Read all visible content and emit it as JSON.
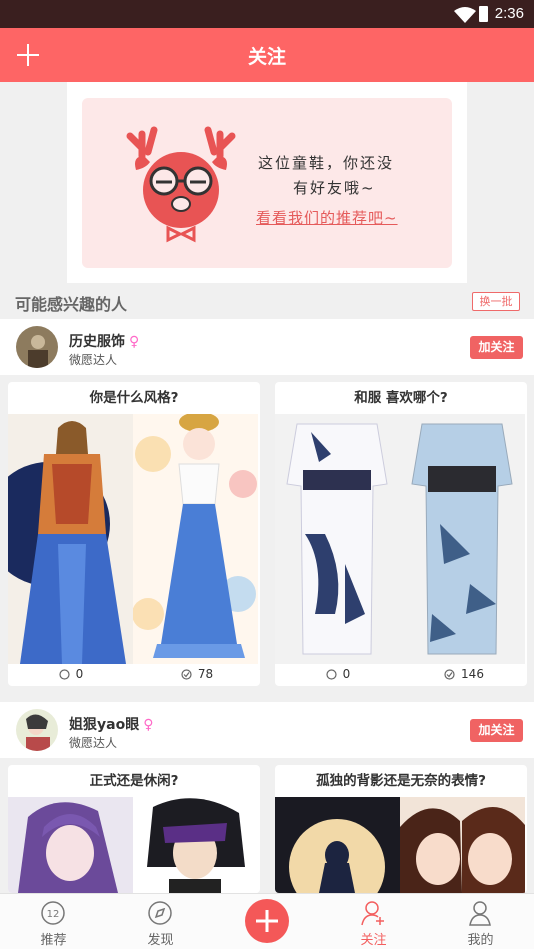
{
  "status_bar": {
    "time": "2:36"
  },
  "header": {
    "title": "关注",
    "add_icon": "plus-icon"
  },
  "banner": {
    "line1": "这位童鞋，你还没",
    "line2": "有好友哦~",
    "link": "看看我们的推荐吧~"
  },
  "recommend": {
    "title": "可能感兴趣的人",
    "refresh_label": "换一批"
  },
  "users": [
    {
      "name": "历史服饰",
      "subtitle": "微愿达人",
      "follow_label": "加关注",
      "cards": [
        {
          "title": "你是什么风格?",
          "comments": "0",
          "votes": "78"
        },
        {
          "title": "和服 喜欢哪个?",
          "comments": "0",
          "votes": "146"
        }
      ]
    },
    {
      "name": "姐狠yao眼",
      "subtitle": "微愿达人",
      "follow_label": "加关注",
      "cards": [
        {
          "title": "正式还是休闲?"
        },
        {
          "title": "孤独的背影还是无奈的表情?"
        }
      ]
    }
  ],
  "tabbar": {
    "items": [
      {
        "label": "推荐",
        "icon": "recommend-icon"
      },
      {
        "label": "发现",
        "icon": "compass-icon"
      },
      {
        "label": "关注",
        "icon": "follow-user-icon",
        "active": true
      },
      {
        "label": "我的",
        "icon": "profile-icon"
      }
    ],
    "badge": "12"
  },
  "colors": {
    "accent": "#fe6565",
    "status_bar": "#3a1f1f",
    "female": "#ff69c8"
  }
}
